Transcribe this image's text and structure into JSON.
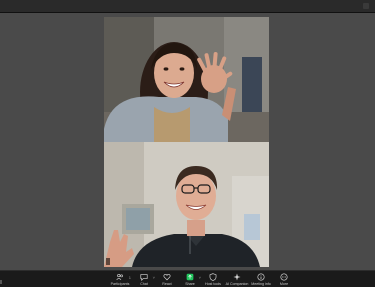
{
  "participants": {
    "top": {
      "name": ""
    },
    "bottom": {
      "name": ""
    }
  },
  "toolbar": {
    "items": [
      {
        "label": "Participants",
        "icon": "people-icon",
        "count": "1"
      },
      {
        "label": "Chat",
        "icon": "chat-icon"
      },
      {
        "label": "React",
        "icon": "heart-icon"
      },
      {
        "label": "Share",
        "icon": "share-icon"
      },
      {
        "label": "Host tools",
        "icon": "shield-icon"
      },
      {
        "label": "AI Companion",
        "icon": "sparkle-icon"
      },
      {
        "label": "Meeting info",
        "icon": "info-icon"
      },
      {
        "label": "More",
        "icon": "more-icon"
      }
    ],
    "share_color": "#22c55e"
  }
}
